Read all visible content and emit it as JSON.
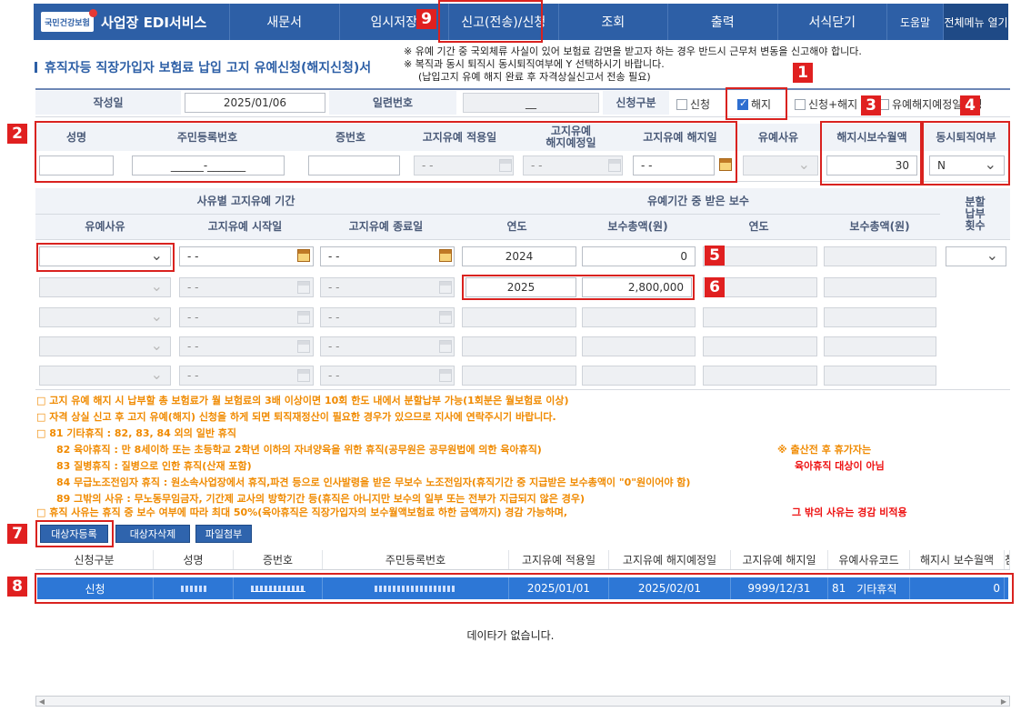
{
  "nav": {
    "logo_text": "국민건강보험",
    "app_title": "사업장 EDI서비스",
    "menu": [
      "새문서",
      "임시저장",
      "신고(전송)/신청",
      "조회",
      "출력",
      "서식닫기",
      "도움말",
      "전체메뉴 열기"
    ]
  },
  "page": {
    "title": "휴직자등 직장가입자 보험료 납입 고지 유예신청(해지신청)서",
    "notice": [
      "※ 유예 기간 중 국외체류 사실이 있어 보험료 감면을 받고자 하는 경우 반드시 근무처 변동을 신고해야 합니다.",
      "※ 복직과 동시 퇴직시 동시퇴직여부에 Y 선택하시기 바랍니다.",
      "(납입고지 유예 해지 완료 후 자격상실신고서 전송 필요)"
    ]
  },
  "header_row": {
    "date_label": "작성일",
    "date_value": "2025/01/06",
    "serial_label": "일련번호",
    "serial_value": "__",
    "type_label": "신청구분",
    "options": [
      {
        "label": "신청",
        "checked": false
      },
      {
        "label": "해지",
        "checked": true
      },
      {
        "label": "신청+해지",
        "checked": false
      },
      {
        "label": "유예해지예정일변경",
        "checked": false
      }
    ]
  },
  "person": {
    "headers": [
      "성명",
      "주민등록번호",
      "증번호",
      "고지유예 적용일",
      "고지유예\n해지예정일",
      "고지유예 해지일",
      "유예사유",
      "해지시보수월액",
      "동시퇴직여부"
    ],
    "name": "",
    "rrn": "______-_______",
    "card_no": "",
    "apply_date": "- -",
    "planned_date": "- -",
    "release_date": "- -",
    "reason": "",
    "monthly_pay": "30",
    "simultaneous_retire": "N"
  },
  "period": {
    "group1": "사유별 고지유예 기간",
    "group2": "유예기간 중 받은 보수",
    "installment": "분할\n납부\n횟수",
    "cols": [
      "유예사유",
      "고지유예 시작일",
      "고지유예 종료일",
      "연도",
      "보수총액(원)",
      "연도",
      "보수총액(원)"
    ],
    "date_placeholder": "- -",
    "rows": [
      {
        "year": "2024",
        "amount": "0"
      },
      {
        "year": "2025",
        "amount": "2,800,000"
      }
    ]
  },
  "info_lines": [
    "□ 고지 유예 해지 시 납부할 총 보험료가 월 보험료의 3배 이상이면 10회 한도 내에서 분할납부 가능(1회분은 월보험료 이상)",
    "□ 자격 상실 신고 후 고지 유예(해지) 신청을 하게 되면 퇴직재정산이 필요한 경우가 있으므로 지사에 연락주시기 바랍니다.",
    "□ 81 기타휴직 : 82, 83, 84 외의 일반 휴직",
    "82 육아휴직 : 만 8세이하 또는 초등학교 2학년 이하의 자녀양육을 위한 휴직(공무원은 공무원법에 의한 육아휴직)",
    "83 질병휴직 : 질병으로 인한 휴직(산재 포함)",
    "84 무급노조전임자 휴직 : 원소속사업장에서 휴직,파견 등으로 인사발령을 받은 무보수 노조전임자(휴직기간 중 지급받은 보수총액이 \"0\"원이어야 함)",
    "89 그밖의 사유 : 무노동무임금자, 기간제 교사의 방학기간 등(휴직은 아니지만 보수의 일부 또는 전부가 지급되지 않은 경우)",
    "□ 휴직 사유는 휴직 중 보수 여부에 따라 최대 50%(육아휴직은 직장가입자의 보수월액보험료 하한 금액까지) 경감 가능하며,"
  ],
  "info_red": [
    "※ 출산전 후 휴가자는",
    "육아휴직 대상이 아님",
    "그 밖의 사유는 경감 비적용"
  ],
  "buttons": [
    "대상자등록",
    "대상자삭제",
    "파일첨부"
  ],
  "grid": {
    "headers": [
      "신청구분",
      "성명",
      "증번호",
      "주민등록번호",
      "고지유예 적용일",
      "고지유예 해지예정일",
      "고지유예 해지일",
      "유예사유코드",
      "해지시 보수월액",
      "첨부"
    ],
    "row": {
      "type": "신청",
      "apply_date": "2025/01/01",
      "planned_date": "2025/02/01",
      "release_date": "9999/12/31",
      "reason_code": "81",
      "reason_name": "기타휴직",
      "monthly_pay": "0"
    },
    "empty_message": "데이타가 없습니다."
  },
  "badges": [
    "1",
    "2",
    "3",
    "4",
    "5",
    "6",
    "7",
    "8",
    "9"
  ],
  "colors": {
    "nav": "#2d5fa6",
    "annotation": "#d9221f",
    "highlight_row": "#2d77d6",
    "info_orange": "#f08a00"
  }
}
